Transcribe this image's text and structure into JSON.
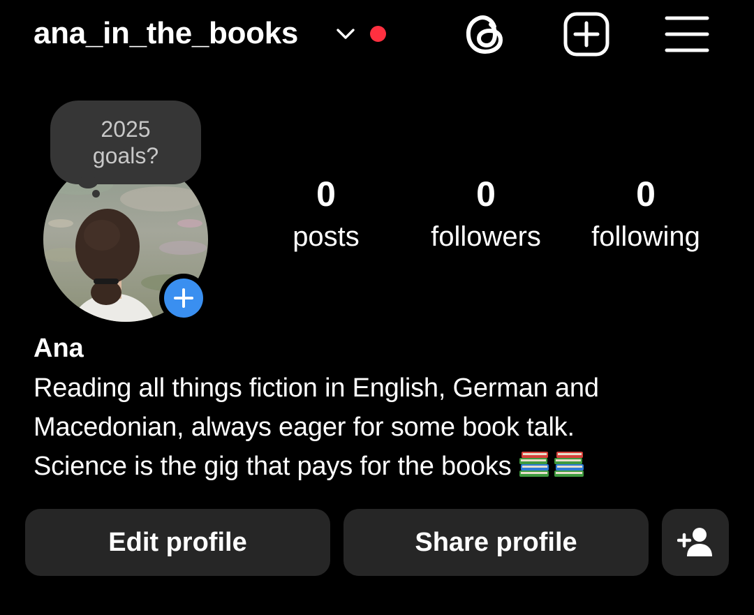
{
  "header": {
    "username": "ana_in_the_books",
    "notification_color": "#ff3040",
    "icons": [
      "chevron-down-icon",
      "threads-icon",
      "add-square-icon",
      "hamburger-menu-icon"
    ]
  },
  "note": {
    "text": "2025\ngoals?"
  },
  "avatar": {
    "add_story_color": "#3a8ff0"
  },
  "stats": {
    "posts": {
      "count": "0",
      "label": "posts"
    },
    "followers": {
      "count": "0",
      "label": "followers"
    },
    "following": {
      "count": "0",
      "label": "following"
    }
  },
  "profile": {
    "name": "Ana",
    "bio": [
      "Reading all things fiction in English, German and",
      "Macedonian, always eager for some book talk.",
      "Science is the gig that pays for the books"
    ],
    "bio_emoji": "books-emoji"
  },
  "actions": {
    "edit_label": "Edit profile",
    "share_label": "Share profile",
    "discover_icon": "add-person-icon"
  }
}
